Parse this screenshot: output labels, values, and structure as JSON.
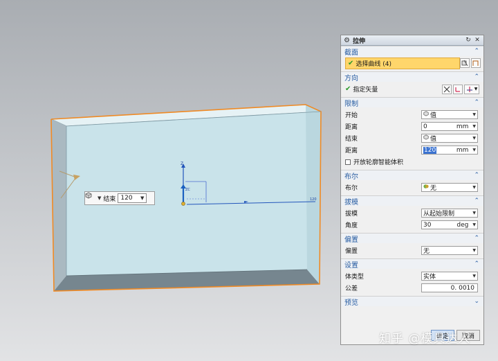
{
  "viewport": {
    "axis_z_label": "Z",
    "axis_zc_label": "ZC",
    "dim_label": "120",
    "floating_control": {
      "end_label": "结束",
      "end_value": "120"
    }
  },
  "dialog": {
    "title": "拉伸",
    "sections": {
      "section": {
        "header": "截面",
        "select_curve_label": "选择曲线 (4)"
      },
      "direction": {
        "header": "方向",
        "specify_vector_label": "指定矢量"
      },
      "limits": {
        "header": "限制",
        "start_label": "开始",
        "start_value": "值",
        "start_distance_label": "距离",
        "start_distance_value": "0",
        "start_distance_unit": "mm",
        "end_label": "结束",
        "end_value": "值",
        "end_distance_label": "距离",
        "end_distance_value": "120",
        "end_distance_unit": "mm",
        "open_profile_label": "开放轮廓智能体积"
      },
      "boolean": {
        "header": "布尔",
        "boolean_label": "布尔",
        "boolean_value": "无"
      },
      "draft": {
        "header": "拔模",
        "draft_label": "拔模",
        "draft_value": "从起始限制",
        "angle_label": "角度",
        "angle_value": "30",
        "angle_unit": "deg"
      },
      "offset": {
        "header": "偏置",
        "offset_label": "偏置",
        "offset_value": "无"
      },
      "settings": {
        "header": "设置",
        "body_type_label": "体类型",
        "body_type_value": "实体",
        "tolerance_label": "公差",
        "tolerance_value": "0. 0010"
      },
      "preview": {
        "header": "预览"
      }
    },
    "footer": {
      "ok_label": "确定",
      "cancel_label": "取消"
    }
  },
  "watermark": "知乎 @模具达人",
  "colors": {
    "accent_blue": "#2b5fa3",
    "selection_yellow": "#ffd66b",
    "body_fill": "#c9e3ea",
    "edge_orange": "#f08a24"
  }
}
